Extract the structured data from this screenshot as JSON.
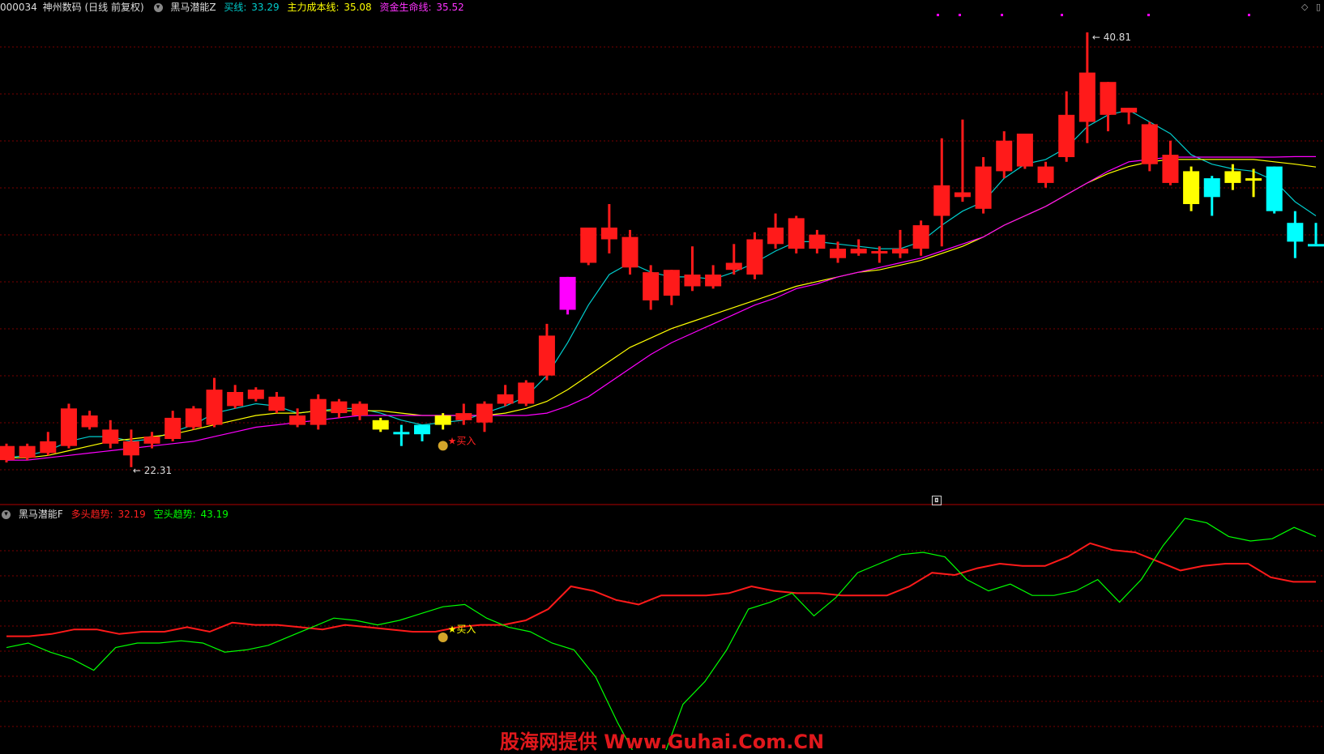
{
  "header": {
    "stock_code": "000034",
    "stock_name": "神州数码",
    "period": "(日线 前复权)",
    "indicator_name": "黑马潜能Z",
    "buy_line_label": "买线:",
    "buy_line_value": "33.29",
    "main_cost_label": "主力成本线:",
    "main_cost_value": "35.08",
    "capital_label": "资金生命线:",
    "capital_value": "35.52"
  },
  "top_right_icons": [
    "diamond-icon",
    "window-icon"
  ],
  "sub_header": {
    "indicator_name": "黑马潜能F",
    "bull_label": "多头趋势:",
    "bull_value": "32.19",
    "bear_label": "空头趋势:",
    "bear_value": "43.19"
  },
  "annotations": {
    "high_label": "40.81",
    "low_label": "22.31",
    "buy_signal": "买入",
    "sub_buy_signal": "买入"
  },
  "watermark": "股海网提供 Www.Guhai.Com.CN",
  "colors": {
    "up": "#ff1a1a",
    "down_cyan": "#00ffff",
    "yellow": "#ffff00",
    "magenta": "#ff00ff",
    "buy_line": "#00cccc",
    "main_cost": "#ffff00",
    "capital": "#ff00ff",
    "bull_trend": "#ff1a1a",
    "bear_trend": "#00ff00",
    "grid": "#7a0000"
  },
  "chart_data": [
    {
      "type": "candlestick",
      "title": "",
      "ylim": [
        21.5,
        41.5
      ],
      "candles": [
        {
          "o": 22.6,
          "c": 23.2,
          "h": 23.3,
          "l": 22.5,
          "color": "red"
        },
        {
          "o": 22.7,
          "c": 23.2,
          "h": 23.3,
          "l": 22.6,
          "color": "red"
        },
        {
          "o": 22.9,
          "c": 23.4,
          "h": 23.8,
          "l": 22.8,
          "color": "red"
        },
        {
          "o": 23.2,
          "c": 24.8,
          "h": 25.0,
          "l": 23.1,
          "color": "red"
        },
        {
          "o": 24.5,
          "c": 24.0,
          "h": 24.7,
          "l": 23.9,
          "color": "red"
        },
        {
          "o": 23.3,
          "c": 23.9,
          "h": 24.3,
          "l": 23.1,
          "color": "red"
        },
        {
          "o": 23.4,
          "c": 22.8,
          "h": 23.9,
          "l": 22.3,
          "color": "red"
        },
        {
          "o": 23.3,
          "c": 23.6,
          "h": 23.8,
          "l": 23.1,
          "color": "red"
        },
        {
          "o": 23.5,
          "c": 24.4,
          "h": 24.7,
          "l": 23.4,
          "color": "red"
        },
        {
          "o": 24.0,
          "c": 24.8,
          "h": 24.9,
          "l": 23.9,
          "color": "red"
        },
        {
          "o": 24.1,
          "c": 25.6,
          "h": 26.1,
          "l": 24.0,
          "color": "red"
        },
        {
          "o": 24.9,
          "c": 25.5,
          "h": 25.8,
          "l": 24.8,
          "color": "red"
        },
        {
          "o": 25.2,
          "c": 25.6,
          "h": 25.7,
          "l": 25.1,
          "color": "red"
        },
        {
          "o": 25.3,
          "c": 24.7,
          "h": 25.5,
          "l": 24.6,
          "color": "red"
        },
        {
          "o": 24.5,
          "c": 24.1,
          "h": 24.8,
          "l": 24.0,
          "color": "red"
        },
        {
          "o": 24.1,
          "c": 25.2,
          "h": 25.4,
          "l": 23.9,
          "color": "red"
        },
        {
          "o": 24.6,
          "c": 25.1,
          "h": 25.2,
          "l": 24.4,
          "color": "red"
        },
        {
          "o": 24.5,
          "c": 25.0,
          "h": 25.1,
          "l": 24.3,
          "color": "red"
        },
        {
          "o": 24.3,
          "c": 23.9,
          "h": 24.4,
          "l": 23.8,
          "color": "yellow"
        },
        {
          "o": 23.8,
          "c": 23.8,
          "h": 24.1,
          "l": 23.2,
          "color": "cyan"
        },
        {
          "o": 24.1,
          "c": 23.7,
          "h": 24.1,
          "l": 23.4,
          "color": "cyan"
        },
        {
          "o": 24.1,
          "c": 24.5,
          "h": 24.6,
          "l": 23.9,
          "color": "yellow"
        },
        {
          "o": 24.3,
          "c": 24.6,
          "h": 25.0,
          "l": 24.1,
          "color": "red"
        },
        {
          "o": 24.2,
          "c": 25.0,
          "h": 25.1,
          "l": 23.8,
          "color": "red"
        },
        {
          "o": 25.0,
          "c": 25.4,
          "h": 25.8,
          "l": 24.9,
          "color": "red"
        },
        {
          "o": 25.0,
          "c": 25.9,
          "h": 26.0,
          "l": 24.9,
          "color": "red"
        },
        {
          "o": 26.2,
          "c": 27.9,
          "h": 28.4,
          "l": 26.0,
          "color": "red"
        },
        {
          "o": 29.0,
          "c": 30.4,
          "h": 30.4,
          "l": 28.8,
          "color": "magenta"
        },
        {
          "o": 31.0,
          "c": 32.5,
          "h": 32.5,
          "l": 30.9,
          "color": "red"
        },
        {
          "o": 32.0,
          "c": 32.5,
          "h": 33.5,
          "l": 31.4,
          "color": "red"
        },
        {
          "o": 30.8,
          "c": 32.1,
          "h": 32.4,
          "l": 30.5,
          "color": "red"
        },
        {
          "o": 29.4,
          "c": 30.6,
          "h": 30.9,
          "l": 29.0,
          "color": "red"
        },
        {
          "o": 29.6,
          "c": 30.7,
          "h": 30.7,
          "l": 29.2,
          "color": "red"
        },
        {
          "o": 30.0,
          "c": 30.5,
          "h": 31.7,
          "l": 29.8,
          "color": "red"
        },
        {
          "o": 30.0,
          "c": 30.5,
          "h": 30.9,
          "l": 29.9,
          "color": "red"
        },
        {
          "o": 30.7,
          "c": 31.0,
          "h": 31.8,
          "l": 30.5,
          "color": "red"
        },
        {
          "o": 30.5,
          "c": 32.0,
          "h": 32.3,
          "l": 30.3,
          "color": "red"
        },
        {
          "o": 31.8,
          "c": 32.5,
          "h": 33.1,
          "l": 31.6,
          "color": "red"
        },
        {
          "o": 31.6,
          "c": 32.9,
          "h": 33.0,
          "l": 31.4,
          "color": "red"
        },
        {
          "o": 31.6,
          "c": 32.2,
          "h": 32.4,
          "l": 31.4,
          "color": "red"
        },
        {
          "o": 31.2,
          "c": 31.6,
          "h": 31.9,
          "l": 31.0,
          "color": "red"
        },
        {
          "o": 31.4,
          "c": 31.6,
          "h": 32.0,
          "l": 31.3,
          "color": "red"
        },
        {
          "o": 31.4,
          "c": 31.5,
          "h": 31.7,
          "l": 31.0,
          "color": "red"
        },
        {
          "o": 31.4,
          "c": 31.6,
          "h": 32.4,
          "l": 31.2,
          "color": "red"
        },
        {
          "o": 31.6,
          "c": 32.6,
          "h": 32.8,
          "l": 31.3,
          "color": "red"
        },
        {
          "o": 33.0,
          "c": 34.3,
          "h": 36.3,
          "l": 31.7,
          "color": "red"
        },
        {
          "o": 33.8,
          "c": 34.0,
          "h": 37.1,
          "l": 33.6,
          "color": "red"
        },
        {
          "o": 33.3,
          "c": 35.1,
          "h": 35.5,
          "l": 33.1,
          "color": "red"
        },
        {
          "o": 34.9,
          "c": 36.2,
          "h": 36.6,
          "l": 34.6,
          "color": "red"
        },
        {
          "o": 35.1,
          "c": 36.5,
          "h": 36.5,
          "l": 35.0,
          "color": "red"
        },
        {
          "o": 34.4,
          "c": 35.1,
          "h": 35.3,
          "l": 34.2,
          "color": "red"
        },
        {
          "o": 35.5,
          "c": 37.3,
          "h": 38.3,
          "l": 35.3,
          "color": "red"
        },
        {
          "o": 37.0,
          "c": 39.1,
          "h": 40.81,
          "l": 36.1,
          "color": "red"
        },
        {
          "o": 37.3,
          "c": 38.7,
          "h": 38.7,
          "l": 36.6,
          "color": "red"
        },
        {
          "o": 37.6,
          "c": 37.4,
          "h": 37.6,
          "l": 36.9,
          "color": "red"
        },
        {
          "o": 35.2,
          "c": 36.9,
          "h": 37.0,
          "l": 34.9,
          "color": "red"
        },
        {
          "o": 34.4,
          "c": 35.6,
          "h": 36.2,
          "l": 34.3,
          "color": "red"
        },
        {
          "o": 34.9,
          "c": 33.5,
          "h": 35.1,
          "l": 33.2,
          "color": "yellow"
        },
        {
          "o": 34.6,
          "c": 33.8,
          "h": 34.7,
          "l": 33.0,
          "color": "cyan"
        },
        {
          "o": 34.4,
          "c": 34.9,
          "h": 35.2,
          "l": 34.1,
          "color": "yellow"
        },
        {
          "o": 34.6,
          "c": 34.6,
          "h": 35.0,
          "l": 33.8,
          "color": "yellow"
        },
        {
          "o": 35.1,
          "c": 33.2,
          "h": 35.1,
          "l": 33.1,
          "color": "cyan"
        },
        {
          "o": 32.7,
          "c": 31.9,
          "h": 33.2,
          "l": 31.2,
          "color": "cyan"
        },
        {
          "o": 31.8,
          "c": 31.8,
          "h": 32.7,
          "l": 31.8,
          "color": "cyan"
        }
      ],
      "series": [
        {
          "name": "买线",
          "values": [
            22.7,
            22.8,
            23.0,
            23.4,
            23.6,
            23.6,
            23.4,
            23.5,
            23.8,
            24.1,
            24.6,
            24.8,
            25.0,
            24.9,
            24.6,
            24.7,
            24.8,
            24.8,
            24.6,
            24.3,
            24.1,
            24.2,
            24.3,
            24.6,
            24.9,
            25.3,
            26.2,
            27.6,
            29.2,
            30.5,
            31.0,
            30.6,
            30.4,
            30.4,
            30.3,
            30.6,
            31.0,
            31.5,
            31.9,
            31.9,
            31.8,
            31.7,
            31.6,
            31.6,
            31.9,
            32.6,
            33.2,
            33.6,
            34.6,
            35.2,
            35.4,
            35.9,
            36.8,
            37.3,
            37.5,
            37.0,
            36.5,
            35.6,
            35.2,
            35.0,
            34.9,
            34.5,
            33.6,
            33.0
          ]
        },
        {
          "name": "主力成本线",
          "values": [
            22.7,
            22.7,
            22.8,
            23.0,
            23.2,
            23.4,
            23.5,
            23.6,
            23.7,
            23.9,
            24.1,
            24.3,
            24.5,
            24.6,
            24.6,
            24.7,
            24.7,
            24.7,
            24.7,
            24.6,
            24.5,
            24.5,
            24.5,
            24.5,
            24.6,
            24.8,
            25.1,
            25.6,
            26.2,
            26.8,
            27.4,
            27.8,
            28.2,
            28.5,
            28.8,
            29.1,
            29.4,
            29.7,
            30.0,
            30.2,
            30.4,
            30.6,
            30.7,
            30.9,
            31.1,
            31.4,
            31.7,
            32.1,
            32.6,
            33.0,
            33.4,
            33.9,
            34.4,
            34.8,
            35.1,
            35.3,
            35.4,
            35.4,
            35.4,
            35.4,
            35.4,
            35.3,
            35.2,
            35.08
          ]
        },
        {
          "name": "资金生命线",
          "values": [
            22.6,
            22.6,
            22.7,
            22.8,
            22.9,
            23.0,
            23.1,
            23.2,
            23.3,
            23.4,
            23.6,
            23.8,
            24.0,
            24.1,
            24.2,
            24.3,
            24.4,
            24.5,
            24.5,
            24.5,
            24.5,
            24.5,
            24.5,
            24.5,
            24.5,
            24.5,
            24.6,
            24.9,
            25.3,
            25.9,
            26.5,
            27.1,
            27.6,
            28.0,
            28.4,
            28.8,
            29.2,
            29.5,
            29.9,
            30.1,
            30.4,
            30.6,
            30.8,
            31.0,
            31.2,
            31.5,
            31.8,
            32.1,
            32.6,
            33.0,
            33.4,
            33.9,
            34.4,
            34.9,
            35.3,
            35.4,
            35.5,
            35.5,
            35.5,
            35.5,
            35.5,
            35.5,
            35.52,
            35.52
          ]
        }
      ]
    },
    {
      "type": "line",
      "title": "",
      "ylim": [
        0,
        100
      ],
      "series": [
        {
          "name": "多头趋势",
          "values": [
            48,
            48,
            49,
            51,
            51,
            49,
            50,
            50,
            52,
            50,
            54,
            53,
            53,
            52,
            51,
            53,
            52,
            51,
            50,
            50,
            52,
            53,
            53,
            55,
            60,
            70,
            68,
            64,
            62,
            66,
            66,
            66,
            67,
            70,
            68,
            67,
            67,
            66,
            66,
            66,
            70,
            76,
            75,
            78,
            80,
            79,
            79,
            83,
            89,
            86,
            85,
            81,
            77,
            79,
            80,
            80,
            74,
            72,
            72
          ]
        },
        {
          "name": "空头趋势",
          "values": [
            43,
            45,
            41,
            38,
            33,
            43,
            45,
            45,
            46,
            45,
            41,
            42,
            44,
            48,
            52,
            56,
            55,
            53,
            55,
            58,
            61,
            62,
            56,
            52,
            50,
            45,
            42,
            30,
            10,
            -8,
            -8,
            18,
            28,
            42,
            60,
            63,
            67,
            57,
            65,
            76,
            80,
            84,
            85,
            83,
            73,
            68,
            71,
            66,
            66,
            68,
            73,
            63,
            73,
            88,
            100,
            98,
            92,
            90,
            91,
            96,
            92
          ]
        }
      ]
    }
  ]
}
